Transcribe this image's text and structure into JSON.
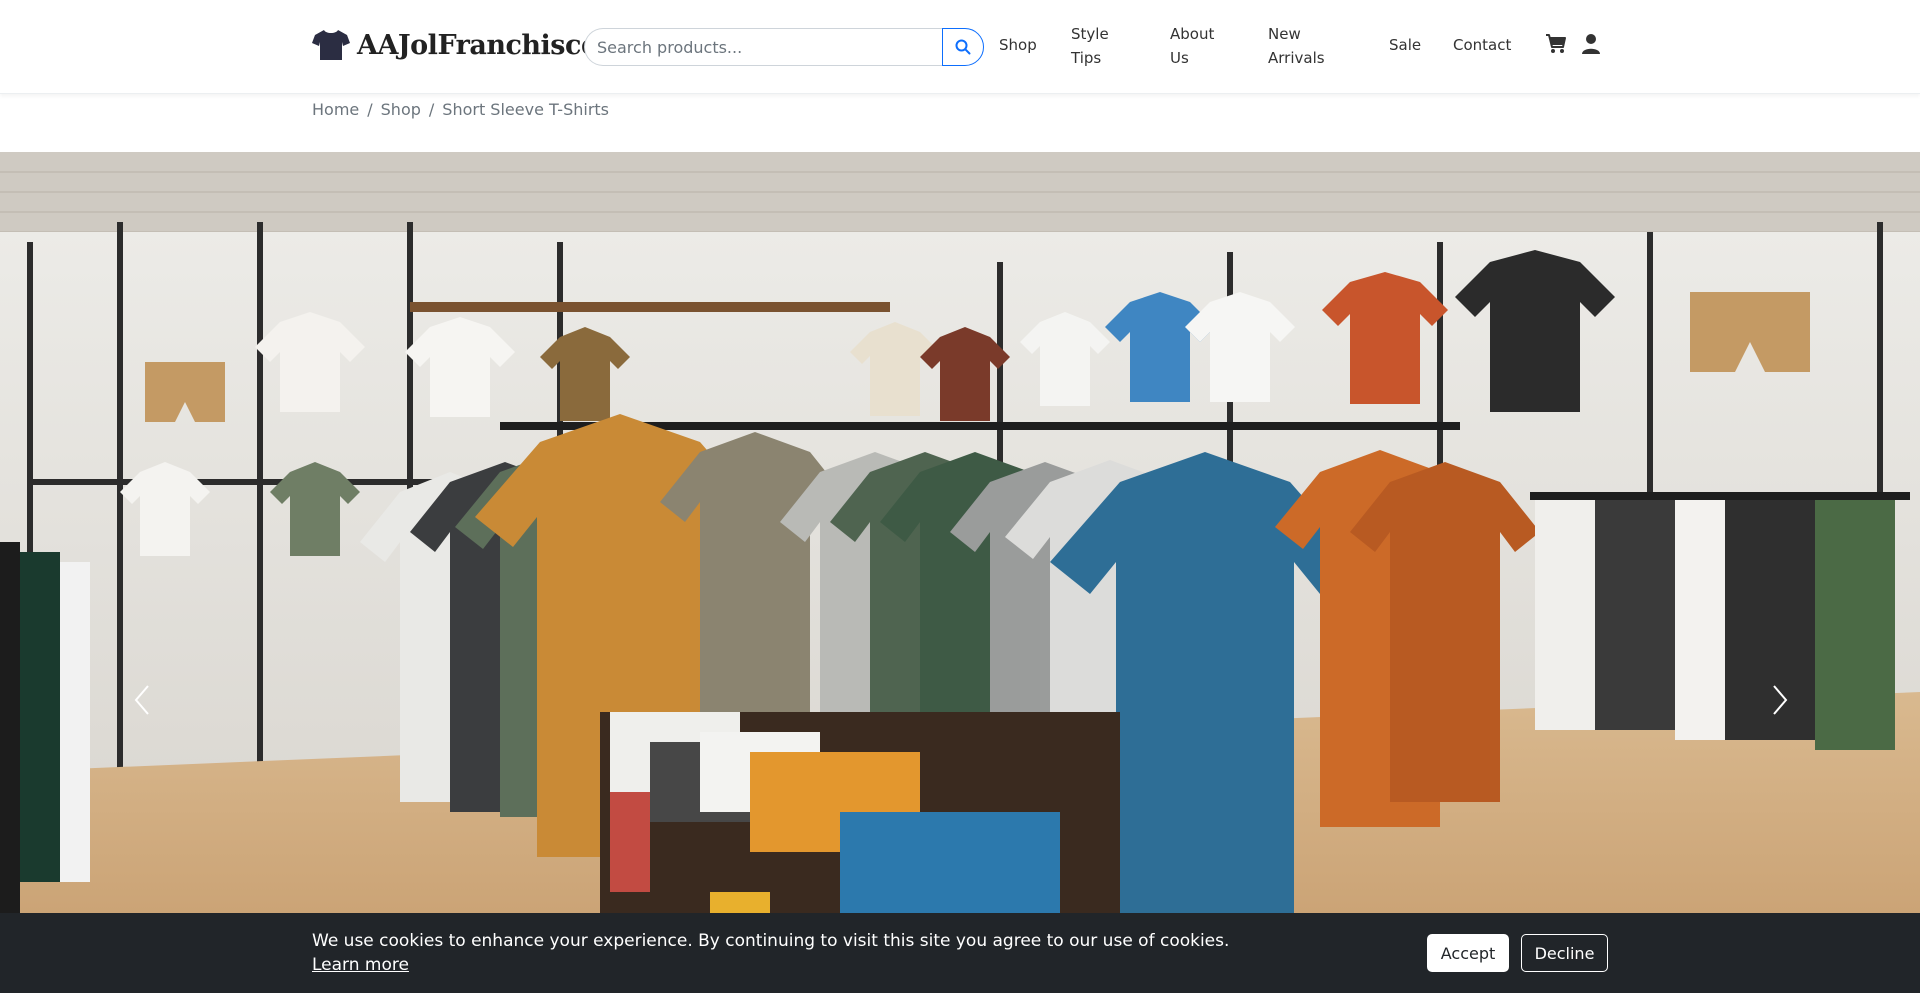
{
  "brand": {
    "name": "AAJolFranchisce",
    "icon": "tshirt-icon"
  },
  "search": {
    "placeholder": "Search products...",
    "value": "",
    "icon": "search-icon"
  },
  "nav": {
    "shop": "Shop",
    "style_tips": "Style Tips",
    "about_us": "About Us",
    "new_arrivals": "New Arrivals",
    "sale": "Sale",
    "contact": "Contact",
    "cart_icon": "cart-icon",
    "user_icon": "user-icon"
  },
  "breadcrumb": {
    "items": [
      "Home",
      "Shop",
      "Short Sleeve T-Shirts"
    ],
    "separator": "/"
  },
  "hero": {
    "image_alt": "Clothing store interior with t-shirts on racks",
    "prev_icon": "chevron-left-icon",
    "next_icon": "chevron-right-icon"
  },
  "cookie": {
    "message": "We use cookies to enhance your experience. By continuing to visit this site you agree to our use of cookies.",
    "learn_more": "Learn more",
    "accept": "Accept",
    "decline": "Decline"
  },
  "colors": {
    "accent": "#0d6efd",
    "cookie_bg": "#212529",
    "text": "#333333"
  }
}
